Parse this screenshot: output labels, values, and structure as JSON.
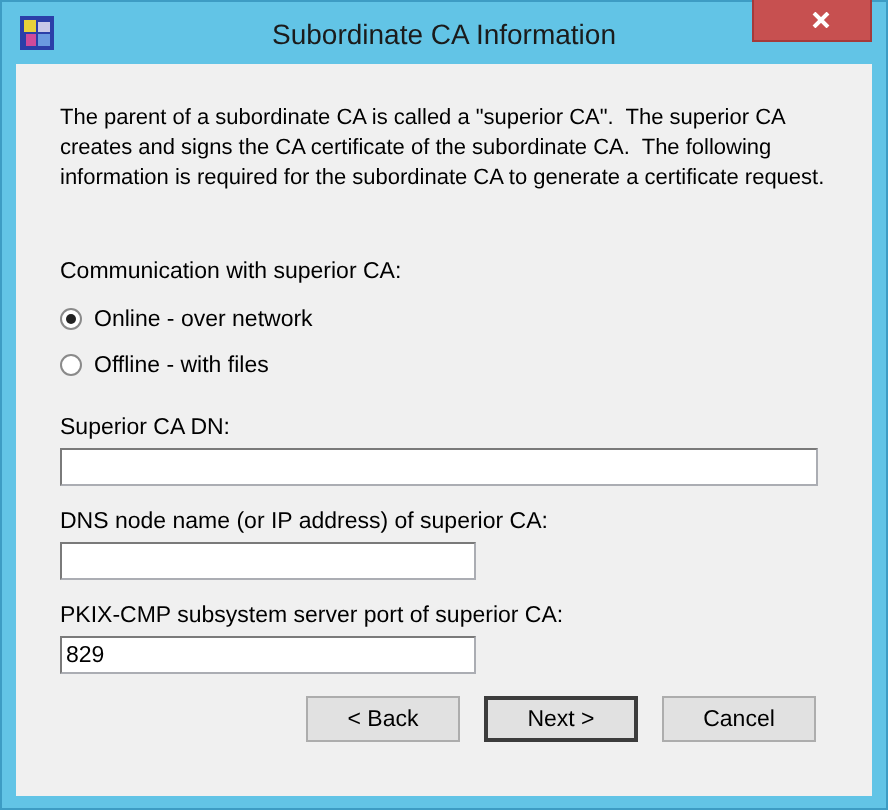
{
  "window": {
    "title": "Subordinate CA Information"
  },
  "description": "The parent of a subordinate CA is called a \"superior CA\".  The superior CA creates and signs the CA certificate of the subordinate CA.  The following information is required for the subordinate CA to generate a certificate request.",
  "communication": {
    "label": "Communication with superior CA:",
    "options": [
      {
        "label": "Online - over network",
        "selected": true
      },
      {
        "label": "Offline - with files",
        "selected": false
      }
    ]
  },
  "fields": [
    {
      "label": "Superior CA DN:",
      "kind": "wide"
    },
    {
      "label": "DNS node name (or IP address) of superior CA:",
      "kind": "short"
    },
    {
      "label": "PKIX-CMP subsystem server port of superior CA:",
      "kind": "short",
      "value": "829"
    }
  ],
  "buttons": [
    {
      "label": "< Back",
      "default": false
    },
    {
      "label": "Next >",
      "default": true
    },
    {
      "label": "Cancel",
      "default": false
    }
  ]
}
